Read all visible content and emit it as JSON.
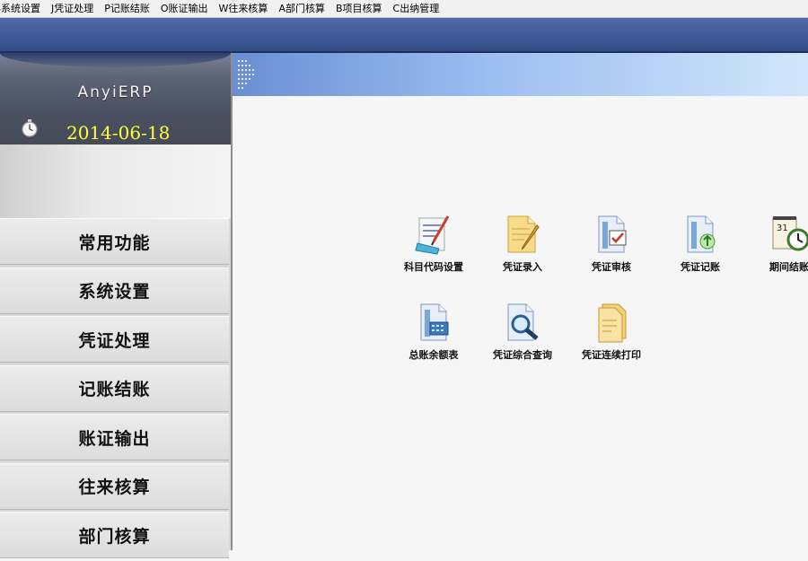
{
  "menu": {
    "items": [
      "S系统设置",
      "J凭证处理",
      "P记账结账",
      "O账证输出",
      "W往来核算",
      "A部门核算",
      "B项目核算",
      "C出纳管理"
    ]
  },
  "sidebar": {
    "brand": "AnyiERP",
    "date": "2014-06-18",
    "nav": [
      "常用功能",
      "系统设置",
      "凭证处理",
      "记账结账",
      "账证输出",
      "往来核算",
      "部门核算"
    ]
  },
  "functions": {
    "items": [
      {
        "label": "科目代码设置",
        "icon": "account-code-icon"
      },
      {
        "label": "凭证录入",
        "icon": "voucher-entry-icon"
      },
      {
        "label": "凭证审核",
        "icon": "voucher-review-icon"
      },
      {
        "label": "凭证记账",
        "icon": "voucher-posting-icon"
      },
      {
        "label": "期间结账",
        "icon": "period-close-icon"
      },
      {
        "label": "总账余额表",
        "icon": "ledger-balance-icon"
      },
      {
        "label": "凭证综合查询",
        "icon": "voucher-query-icon"
      },
      {
        "label": "凭证连续打印",
        "icon": "voucher-print-icon"
      }
    ]
  },
  "colors": {
    "date_text": "#ffff3a",
    "toolbar_blue": "#3d5895",
    "banner_light": "#d2e6fb"
  }
}
